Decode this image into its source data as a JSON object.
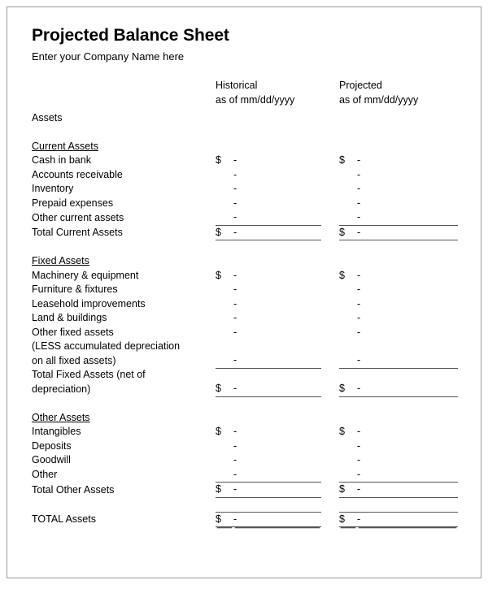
{
  "document": {
    "title": "Projected Balance Sheet",
    "subtitle": "Enter your Company Name here"
  },
  "columns": {
    "label_header": "",
    "historical": {
      "name": "Historical",
      "as_of": "as of mm/dd/yyyy"
    },
    "projected": {
      "name": "Projected",
      "as_of": "as of mm/dd/yyyy"
    }
  },
  "symbols": {
    "currency": "$",
    "empty_value": "-"
  },
  "sections": {
    "assets_heading": "Assets",
    "current_assets": {
      "heading": "Current Assets",
      "rows": [
        {
          "label": "Cash in bank",
          "historical": "-",
          "projected": "-",
          "currency": true
        },
        {
          "label": "Accounts receivable",
          "historical": "-",
          "projected": "-",
          "currency": false
        },
        {
          "label": "Inventory",
          "historical": "-",
          "projected": "-",
          "currency": false
        },
        {
          "label": "Prepaid expenses",
          "historical": "-",
          "projected": "-",
          "currency": false
        },
        {
          "label": "Other current assets",
          "historical": "-",
          "projected": "-",
          "currency": false
        }
      ],
      "total": {
        "label": "Total Current Assets",
        "historical": "-",
        "projected": "-",
        "currency": "$"
      }
    },
    "fixed_assets": {
      "heading": "Fixed Assets",
      "rows": [
        {
          "label": "Machinery & equipment",
          "historical": "-",
          "projected": "-",
          "currency": true
        },
        {
          "label": "Furniture & fixtures",
          "historical": "-",
          "projected": "-",
          "currency": false
        },
        {
          "label": "Leasehold improvements",
          "historical": "-",
          "projected": "-",
          "currency": false
        },
        {
          "label": "Land & buildings",
          "historical": "-",
          "projected": "-",
          "currency": false
        },
        {
          "label": "Other fixed assets",
          "historical": "-",
          "projected": "-",
          "currency": false
        }
      ],
      "depreciation": {
        "line1": "(LESS accumulated depreciation",
        "line2": "on all fixed assets)",
        "historical": "-",
        "projected": "-"
      },
      "total": {
        "line1": "Total Fixed Assets (net of",
        "line2": "depreciation)",
        "historical": "-",
        "projected": "-",
        "currency": "$"
      }
    },
    "other_assets": {
      "heading": "Other Assets",
      "rows": [
        {
          "label": "Intangibles",
          "historical": "-",
          "projected": "-",
          "currency": true
        },
        {
          "label": "Deposits",
          "historical": "-",
          "projected": "-",
          "currency": false
        },
        {
          "label": "Goodwill",
          "historical": "-",
          "projected": "-",
          "currency": false
        },
        {
          "label": "Other",
          "historical": "-",
          "projected": "-",
          "currency": false
        }
      ],
      "total": {
        "label": "Total Other Assets",
        "historical": "-",
        "projected": "-",
        "currency": "$"
      }
    },
    "grand_total": {
      "label": "TOTAL Assets",
      "historical": "-",
      "projected": "-",
      "currency": "$"
    }
  }
}
